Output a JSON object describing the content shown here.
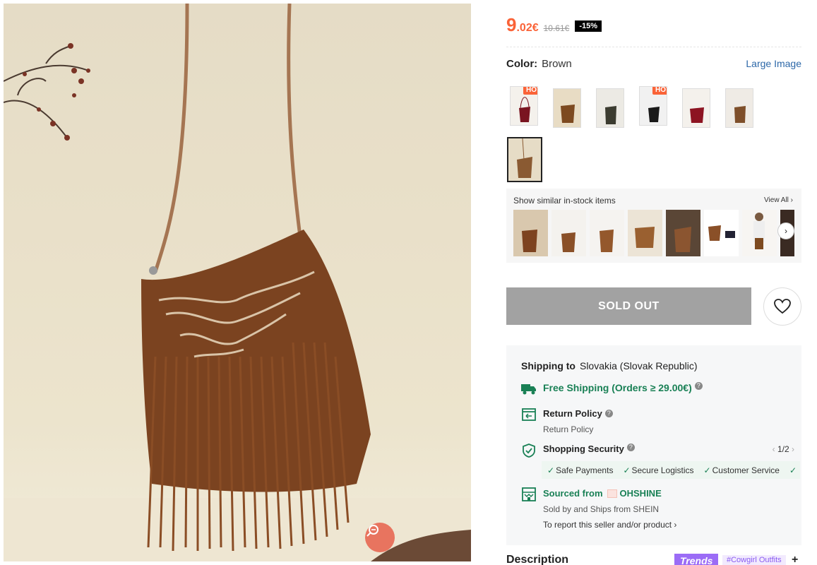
{
  "price": {
    "integer": "9",
    "decimal": ".02€",
    "original": "10.61€",
    "discount": "-15%"
  },
  "color": {
    "label": "Color:",
    "value": "Brown",
    "large_image": "Large Image"
  },
  "swatches": [
    {
      "badge": "HOT",
      "color": "#7a1420"
    },
    {
      "badge": "",
      "color": "#7d4a20"
    },
    {
      "badge": "",
      "color": "#3c3c30"
    },
    {
      "badge": "HOT",
      "color": "#1a1a1a"
    },
    {
      "badge": "",
      "color": "#8d1422"
    },
    {
      "badge": "",
      "color": "#7e4f2a"
    },
    {
      "badge": "",
      "color": "#8a5a32"
    }
  ],
  "similar": {
    "title": "Show similar in-stock items",
    "view_all": "View All ›"
  },
  "sold_out": "SOLD OUT",
  "shipping": {
    "label": "Shipping to",
    "country": "Slovakia (Slovak Republic)",
    "free": "Free Shipping (Orders ≥ 29.00€)",
    "return_title": "Return Policy",
    "return_sub": "Return Policy",
    "security_title": "Shopping Security",
    "pager": "1/2",
    "features": [
      "Safe Payments",
      "Secure Logistics",
      "Customer Service",
      ""
    ],
    "sourced_label": "Sourced from",
    "brand": "OHSHINE",
    "sold_by": "Sold by and Ships from SHEIN",
    "report": "To report this seller and/or product ›"
  },
  "description": {
    "title": "Description",
    "trends": "Trends",
    "tag": "#Cowgirl Outfits",
    "plus": "+"
  },
  "colors": {
    "accent": "#fa6338",
    "green": "#198055",
    "link": "#2d68a8"
  }
}
